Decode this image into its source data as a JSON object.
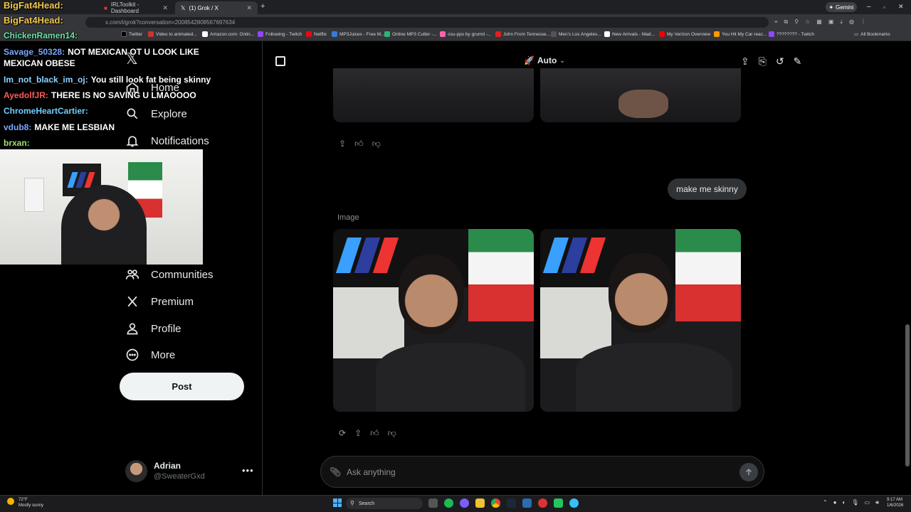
{
  "browser": {
    "tabs": [
      {
        "label": "IRLToolkit - Dashboard",
        "active": false
      },
      {
        "label": "(1) Grok / X",
        "active": true
      }
    ],
    "url": "x.com/i/grok?conversation=2008542808567697634",
    "gemini_label": "Gemini",
    "bookmarks": [
      "Twitter",
      "Video to animated...",
      "Amazon.com: Onlin...",
      "Following - Twitch",
      "Netflix",
      "MP3Juices - Free M...",
      "Online MP3 Cutter -...",
      "osu-pps by grumd -...",
      "John From Tennesse...",
      "Men's Los Angeles...",
      "New Arrivals - Mad...",
      "My Verizon Overview",
      "You Hit My Car reac...",
      "???????? - Twitch"
    ],
    "all_bookmarks": "All Bookmarks"
  },
  "overlay": {
    "chat": [
      {
        "user": "BigFat4Head:",
        "text": "",
        "color": "#f2c94c"
      },
      {
        "user": "BigFat4Head:",
        "text": "",
        "color": "#f2c94c"
      },
      {
        "user": "ChickenRamen14:",
        "text": "",
        "color": "#6fe3a8"
      },
      {
        "user": "Savage_50328:",
        "text": "NOT MEXICAN OT U LOOK LIKE",
        "color": "#7aa7ff"
      },
      {
        "user": "",
        "text": "MEXICAN OBESE",
        "color": "#ffffff"
      },
      {
        "user": "Im_not_black_im_oj:",
        "text": "You still look fat being skinny",
        "color": "#8fd3ff"
      },
      {
        "user": "AyedolfJR:",
        "text": "THERE IS NO SAVING U LMAOOOO",
        "color": "#ff5a5a"
      },
      {
        "user": "ChromeHeartCartier:",
        "text": "",
        "color": "#6fd0ff"
      },
      {
        "user": "vdub8:",
        "text": "MAKE ME LESBIAN",
        "color": "#7aa7ff"
      },
      {
        "user": "brxan:",
        "text": "",
        "color": "#9be36f"
      }
    ]
  },
  "sidebar": {
    "items": [
      {
        "label": "Home",
        "icon": "home-icon"
      },
      {
        "label": "Explore",
        "icon": "search-icon"
      },
      {
        "label": "Notifications",
        "icon": "bell-icon"
      },
      {
        "label": "Communities",
        "icon": "communities-icon"
      },
      {
        "label": "Premium",
        "icon": "x-logo-icon"
      },
      {
        "label": "Profile",
        "icon": "person-icon"
      },
      {
        "label": "More",
        "icon": "more-circle-icon"
      }
    ],
    "post_label": "Post",
    "user": {
      "name": "Adrian",
      "handle": "@SweaterGxd"
    }
  },
  "header": {
    "mode_label": "Auto"
  },
  "conversation": {
    "user_message": "make me skinny",
    "image_label": "Image"
  },
  "composer": {
    "placeholder": "Ask anything"
  },
  "taskbar": {
    "weather_temp": "72°F",
    "weather_desc": "Mostly sunny",
    "search_label": "Search",
    "time": "9:17 AM",
    "date": "1/6/2026"
  }
}
